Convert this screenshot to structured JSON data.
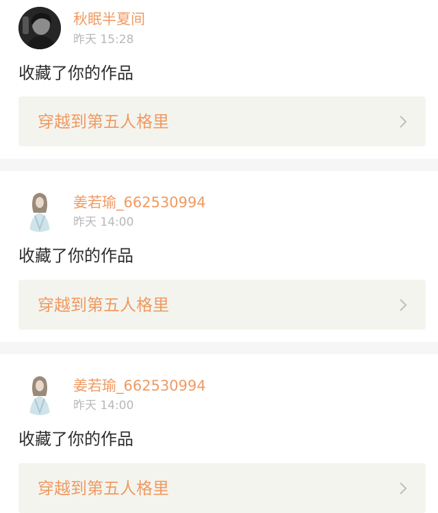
{
  "notifications": [
    {
      "username": "秋眠半夏间",
      "time": "昨天 15:28",
      "action": "收藏了你的作品",
      "work_title": "穿越到第五人格里",
      "avatar_icon": "dark-portrait-avatar"
    },
    {
      "username": "姜若瑜_662530994",
      "time": "昨天 14:00",
      "action": "收藏了你的作品",
      "work_title": "穿越到第五人格里",
      "avatar_icon": "light-portrait-avatar"
    },
    {
      "username": "姜若瑜_662530994",
      "time": "昨天 14:00",
      "action": "收藏了你的作品",
      "work_title": "穿越到第五人格里",
      "avatar_icon": "light-portrait-avatar"
    }
  ],
  "colors": {
    "accent": "#ef9a62",
    "muted": "#b8b8b8",
    "card_bg": "#f4f4ee",
    "separator": "#f6f6f6"
  }
}
